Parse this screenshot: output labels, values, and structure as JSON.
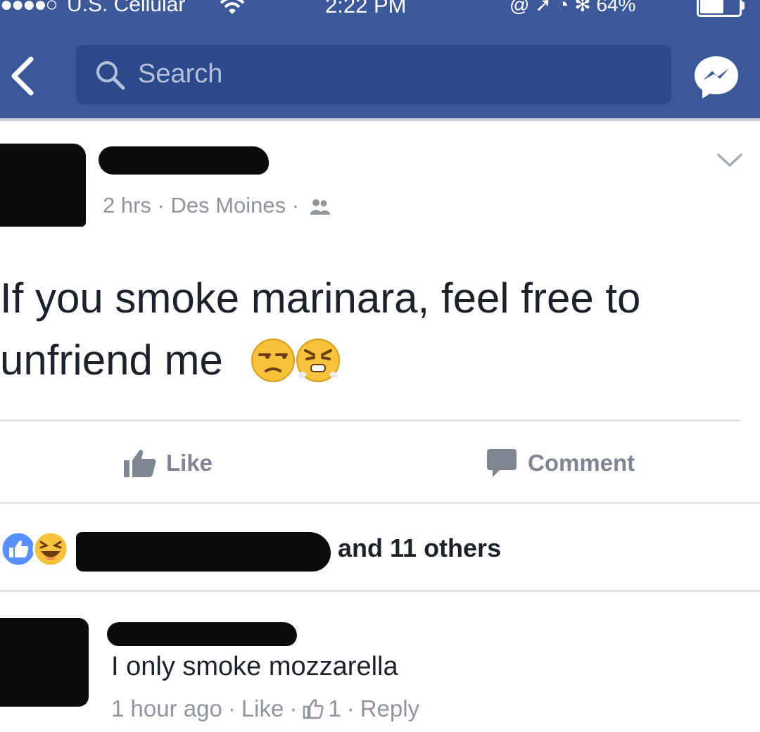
{
  "status_bar": {
    "signal_dots": "●●●●○",
    "carrier": "U.S. Cellular",
    "time": "2:22 PM",
    "right_icons": "@ ➚ ◔ ✻",
    "battery_percent": "64%",
    "battery_level": 0.64
  },
  "nav": {
    "back_icon": "chevron-left-icon",
    "search_placeholder": "Search",
    "messenger_icon": "messenger-icon",
    "brand_color": "#3b5998"
  },
  "post": {
    "meta": "2 hrs · Des Moines ·",
    "audience_icon": "friends-icon",
    "text_line1": "If you smoke marinara, feel free to",
    "text_line2": "unfriend me",
    "emojis": [
      "unamused-face-emoji",
      "steam-nose-face-emoji"
    ]
  },
  "actions": {
    "like_label": "Like",
    "comment_label": "Comment"
  },
  "reactions": {
    "icons": [
      "like-reaction-icon",
      "haha-reaction-icon"
    ],
    "summary": "and 11 others"
  },
  "comment": {
    "text": "I only smoke mozzarella",
    "time": "1 hour ago",
    "like_label": "Like",
    "like_count": "1",
    "reply_label": "Reply"
  }
}
